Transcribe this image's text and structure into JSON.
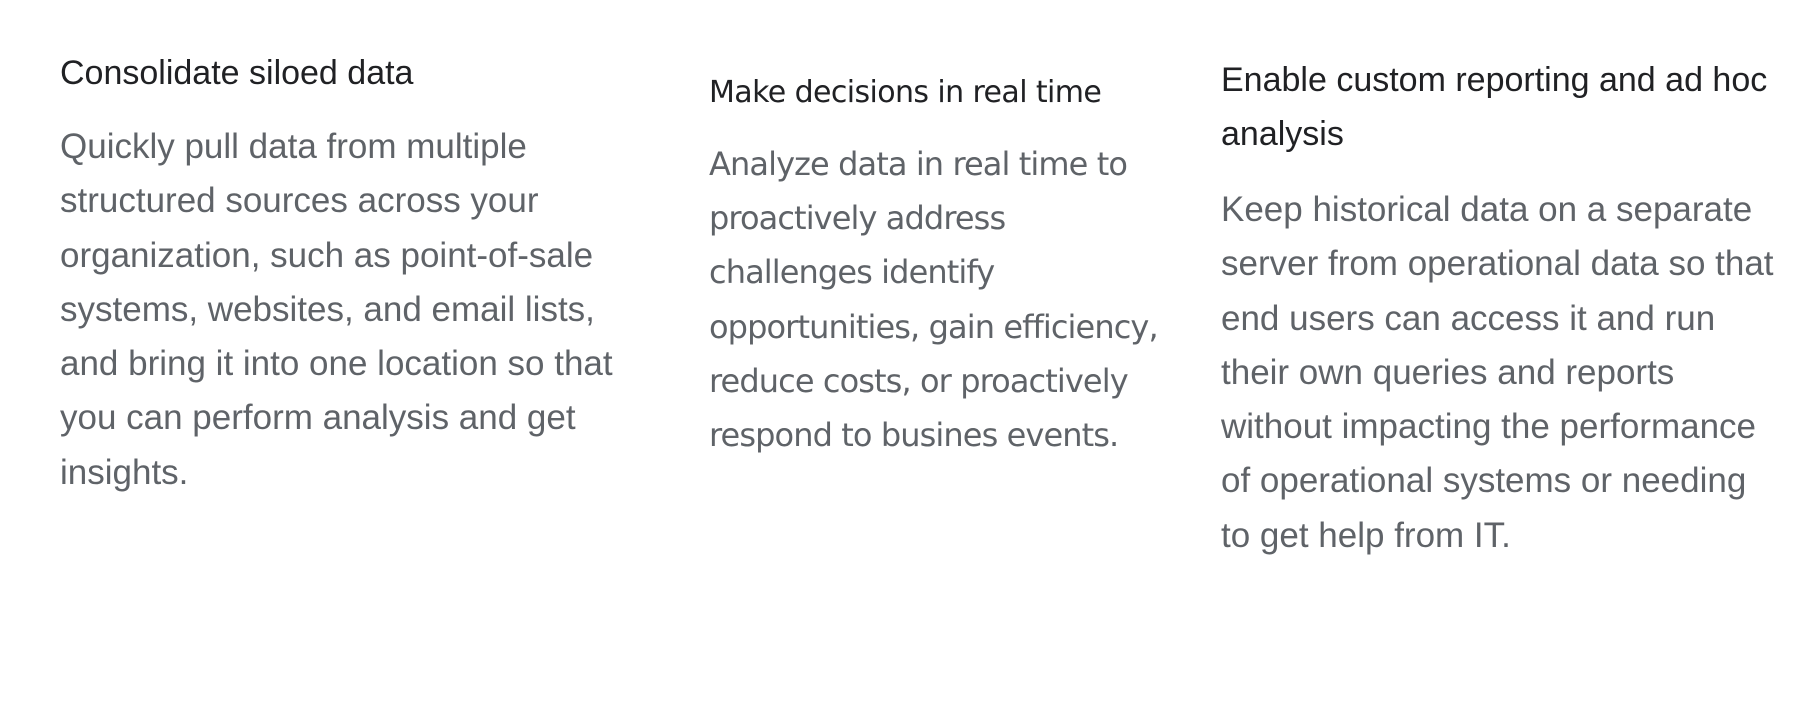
{
  "features": [
    {
      "title": "Consolidate siloed data",
      "description": "Quickly pull data from multiple structured sources across your organization, such as point-of-sale systems, websites, and email lists, and bring it into one location so that you can perform analysis and get insights."
    },
    {
      "title": "Make decisions in real time",
      "description": "Analyze data in real time to proactively address challenges identify opportunities, gain efficiency, reduce costs, or proactively respond to busines events."
    },
    {
      "title": "Enable custom reporting and ad hoc analysis",
      "description": "Keep historical data on a separate server from operational data so that end users can access it and run their own queries and reports without impacting the performance of operational systems or needing to get help from IT."
    }
  ]
}
